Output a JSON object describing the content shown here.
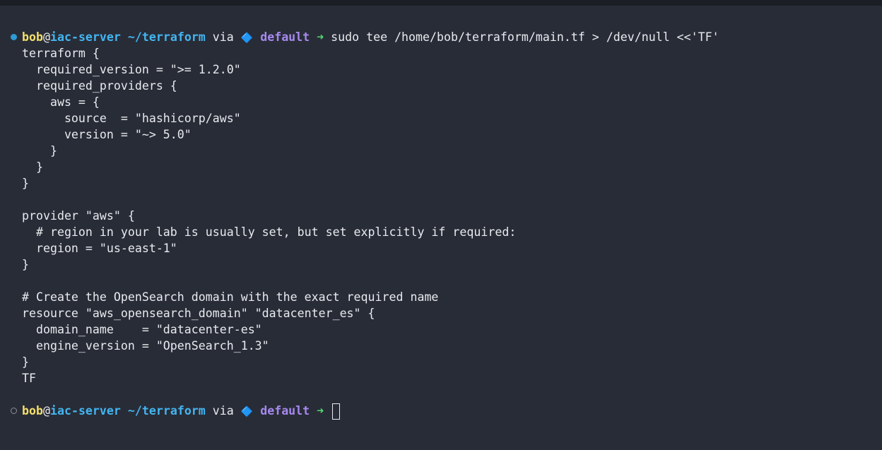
{
  "prompt": {
    "user": "bob",
    "at": "@",
    "host": "iac-server",
    "path": "~/terraform",
    "via": "via",
    "diamond": "🔷",
    "workspace": "default",
    "arrow": "➜"
  },
  "command": "sudo tee /home/bob/terraform/main.tf > /dev/null <<'TF'",
  "heredoc_lines": [
    "terraform {",
    "  required_version = \">= 1.2.0\"",
    "  required_providers {",
    "    aws = {",
    "      source  = \"hashicorp/aws\"",
    "      version = \"~> 5.0\"",
    "    }",
    "  }",
    "}",
    "",
    "provider \"aws\" {",
    "  # region in your lab is usually set, but set explicitly if required:",
    "  region = \"us-east-1\"",
    "}",
    "",
    "# Create the OpenSearch domain with the exact required name",
    "resource \"aws_opensearch_domain\" \"datacenter_es\" {",
    "  domain_name    = \"datacenter-es\"",
    "  engine_version = \"OpenSearch_1.3\"",
    "}",
    "TF"
  ],
  "colors": {
    "background": "#282c37",
    "user": "#f4df6b",
    "host": "#43b5f0",
    "workspace": "#a689ee",
    "arrow": "#4fdc6c",
    "status_dot": "#2e9bd6"
  }
}
